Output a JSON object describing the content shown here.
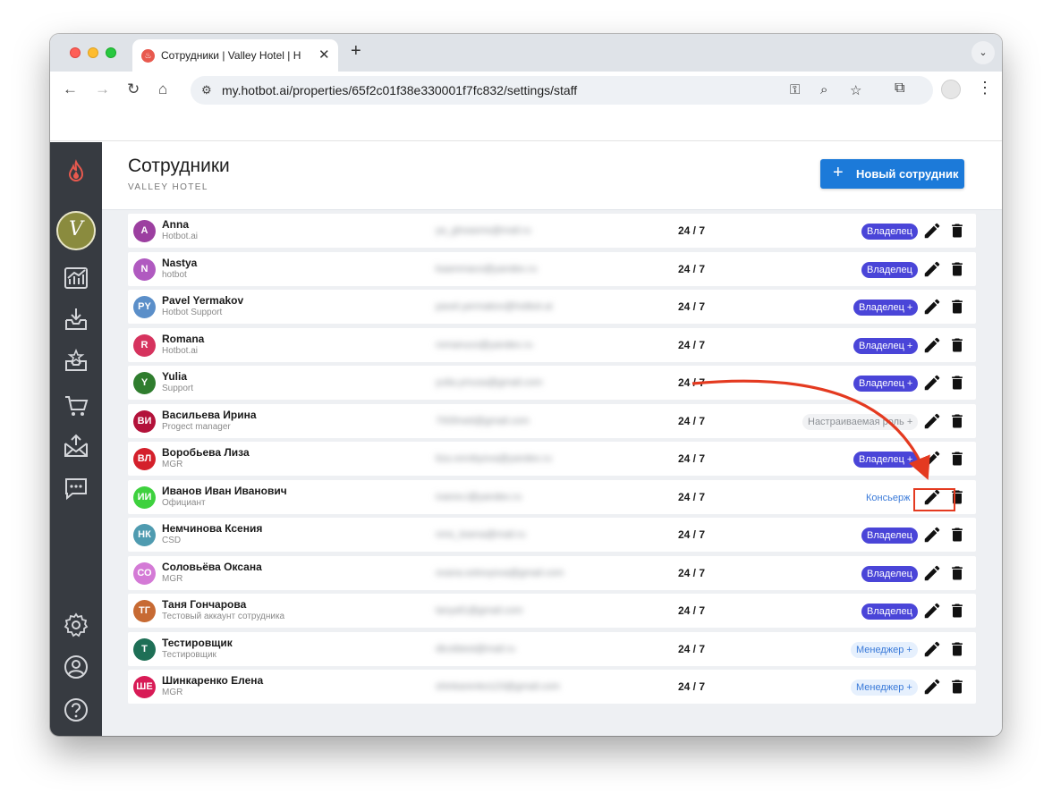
{
  "browser": {
    "tab_title": "Сотрудники | Valley Hotel | H",
    "tab_close": "✕",
    "new_tab": "+",
    "url": "my.hotbot.ai/properties/65f2c01f38e330001f7fc832/settings/staff"
  },
  "header": {
    "title": "Сотрудники",
    "subtitle": "VALLEY HOTEL",
    "new_button_label": "Новый сотрудник",
    "new_button_icon": "+"
  },
  "sidebar": {
    "icons": [
      "flame-logo-icon",
      "hotel-avatar",
      "analytics-icon",
      "inbox-icon",
      "reviews-icon",
      "cart-icon",
      "mail-outbox-icon",
      "chat-icon",
      "settings-icon",
      "account-icon",
      "help-icon"
    ],
    "hotel_avatar_letter": "V"
  },
  "colors": {
    "accent": "#1c7ad9",
    "owner_badge": "#4a45d8",
    "sidebar": "#373b41",
    "annotation": "#e43a20"
  },
  "staff": [
    {
      "initials": "A",
      "name": "Anna",
      "subtitle": "Hotbot.ai",
      "email": "ya_ghoasms@mail.ru",
      "hours": "24 / 7",
      "role": "Владелец",
      "role_type": "owner",
      "color": "#9c3fa0"
    },
    {
      "initials": "N",
      "name": "Nastya",
      "subtitle": "hotbot",
      "email": "kaammaco@yandex.ru",
      "hours": "24 / 7",
      "role": "Владелец",
      "role_type": "owner",
      "color": "#b05ac0"
    },
    {
      "initials": "PY",
      "name": "Pavel Yermakov",
      "subtitle": "Hotbot Support",
      "email": "pavel.yermakov@hotbot.ai",
      "hours": "24 / 7",
      "role": "Владелец +",
      "role_type": "owner",
      "color": "#5b8fc9"
    },
    {
      "initials": "R",
      "name": "Romana",
      "subtitle": "Hotbot.ai",
      "email": "romanuco@yandex.ru",
      "hours": "24 / 7",
      "role": "Владелец +",
      "role_type": "owner",
      "color": "#d6335e"
    },
    {
      "initials": "Y",
      "name": "Yulia",
      "subtitle": "Support",
      "email": "yulia.ymusa@gmail.com",
      "hours": "24 / 7",
      "role": "Владелец +",
      "role_type": "owner",
      "color": "#2f7d2e"
    },
    {
      "initials": "ВИ",
      "name": "Васильева Ирина",
      "subtitle": "Progect manager",
      "email": "79Sfmeti@gmail.com",
      "hours": "24 / 7",
      "role": "Настраиваемая роль +",
      "role_type": "custom",
      "color": "#b3123a"
    },
    {
      "initials": "ВЛ",
      "name": "Воробьева Лиза",
      "subtitle": "MGR",
      "email": "liza.vorobyova@yandex.ru",
      "hours": "24 / 7",
      "role": "Владелец +",
      "role_type": "owner",
      "color": "#d4202b"
    },
    {
      "initials": "ИИ",
      "name": "Иванов Иван Иванович",
      "subtitle": "Официант",
      "email": "ivanov.i@yandex.ru",
      "hours": "24 / 7",
      "role": "Консьерж",
      "role_type": "concierge",
      "color": "#3ed13e"
    },
    {
      "initials": "НК",
      "name": "Немчинова Ксения",
      "subtitle": "CSD",
      "email": "nms_ksena@mail.ru",
      "hours": "24 / 7",
      "role": "Владелец",
      "role_type": "owner",
      "color": "#4f9bb0"
    },
    {
      "initials": "СО",
      "name": "Соловьёва Оксана",
      "subtitle": "MGR",
      "email": "oxana.solovyova@gmail.com",
      "hours": "24 / 7",
      "role": "Владелец",
      "role_type": "owner",
      "color": "#d47ad6"
    },
    {
      "initials": "ТГ",
      "name": "Таня Гончарова",
      "subtitle": "Тестовый аккаунт сотрудника",
      "email": "tanyaf1@gmail.com",
      "hours": "24 / 7",
      "role": "Владелец",
      "role_type": "owner",
      "color": "#c76a33"
    },
    {
      "initials": "Т",
      "name": "Тестировщик",
      "subtitle": "Тестировщик",
      "email": "dtcobtest@mail.ru",
      "hours": "24 / 7",
      "role": "Менеджер +",
      "role_type": "manager",
      "color": "#1e6f56"
    },
    {
      "initials": "ШЕ",
      "name": "Шинкаренко Елена",
      "subtitle": "MGR",
      "email": "shinkarenko123@gmail.com",
      "hours": "24 / 7",
      "role": "Менеджер +",
      "role_type": "manager",
      "color": "#d81b56"
    }
  ]
}
